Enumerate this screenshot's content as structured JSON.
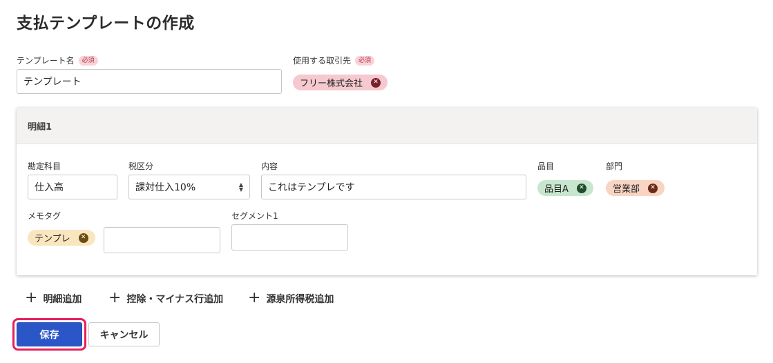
{
  "page": {
    "title": "支払テンプレートの作成"
  },
  "required_badge": "必須",
  "template_name": {
    "label": "テンプレート名",
    "value": "テンプレート"
  },
  "partner": {
    "label": "使用する取引先",
    "tag": "フリー株式会社"
  },
  "detail": {
    "header": "明細1",
    "account": {
      "label": "勘定科目",
      "value": "仕入高"
    },
    "tax": {
      "label": "税区分",
      "value": "課対仕入10%"
    },
    "content": {
      "label": "内容",
      "value": "これはテンプレです"
    },
    "item": {
      "label": "品目",
      "tag": "品目A"
    },
    "department": {
      "label": "部門",
      "tag": "営業部"
    },
    "memo_tag": {
      "label": "メモタグ",
      "tag": "テンプレ",
      "input_value": ""
    },
    "segment1": {
      "label": "セグメント1",
      "value": ""
    }
  },
  "actions": {
    "add_detail": "明細追加",
    "add_deduction": "控除・マイナス行追加",
    "add_withholding": "源泉所得税追加",
    "plus_icon": "+"
  },
  "buttons": {
    "save": "保存",
    "cancel": "キャンセル"
  },
  "icons": {
    "remove": "remove-x-icon"
  },
  "colors": {
    "primary": "#2b56c8",
    "focus_ring": "#e61e5c",
    "required_bg": "#f9d2d7"
  }
}
